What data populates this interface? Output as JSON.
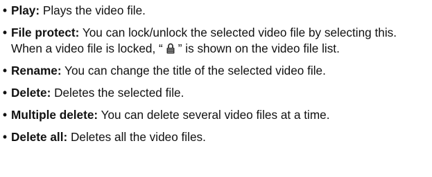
{
  "bullet_char": "•",
  "items": [
    {
      "term": "Play:",
      "text": " Plays the video file."
    },
    {
      "term": "File protect:",
      "text_before_icon": " You can lock/unlock the selected video file by selecting this. When a video file is locked, “",
      "icon": "lock-icon",
      "text_after_icon": "” is shown on the video file list."
    },
    {
      "term": "Rename:",
      "text": " You can change the title of the selected video file."
    },
    {
      "term": "Delete:",
      "text": " Deletes the selected file."
    },
    {
      "term": "Multiple delete:",
      "text": " You can delete several video files at a time."
    },
    {
      "term": "Delete all:",
      "text": " Deletes all the video files."
    }
  ],
  "colors": {
    "text": "#111111",
    "icon": "#333333"
  }
}
